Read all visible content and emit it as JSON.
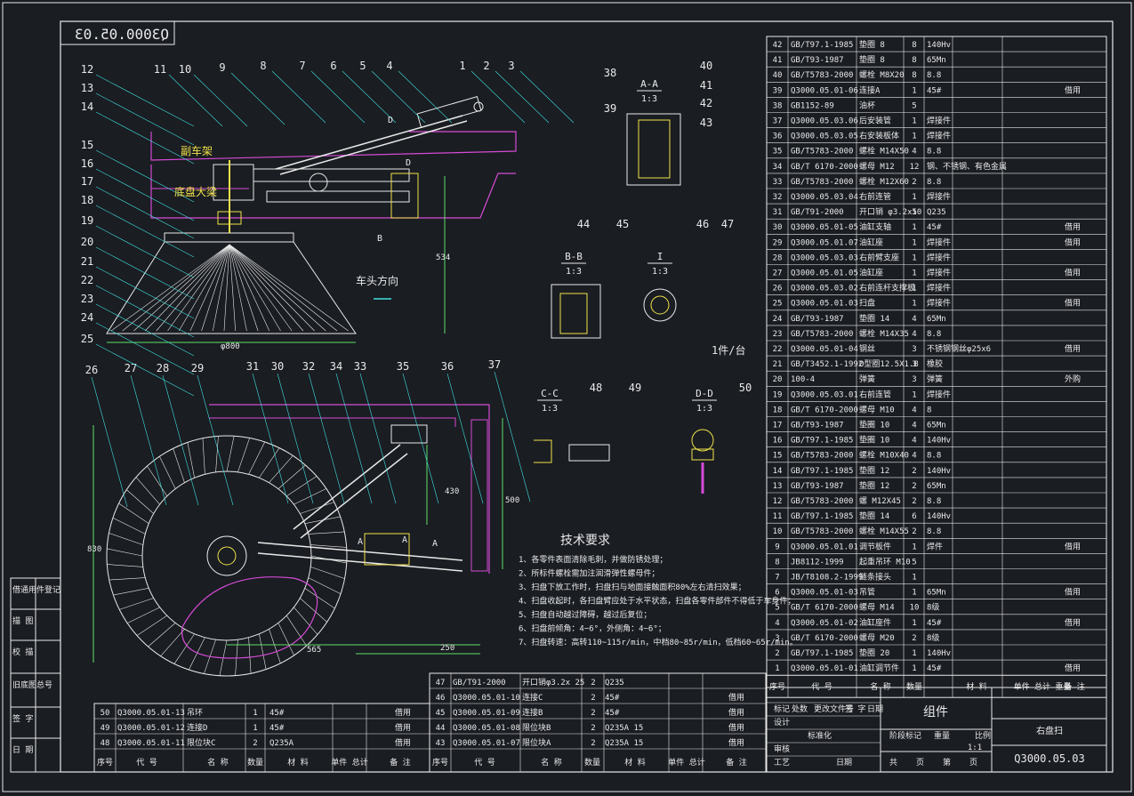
{
  "drawing": {
    "mirror_number": "Q3000.05.03",
    "title_block": {
      "name": "组件",
      "code": "Q3000.05.03",
      "scale_note": "1:1",
      "right_label": "右盘扫"
    },
    "notes_quantity": "1件/台",
    "direction_label": "车头方向",
    "frame_labels": {
      "top": "副车架",
      "bottom": "底盘大梁"
    },
    "dimensions": {
      "d1": "534",
      "d2": "φ800",
      "d3": "430",
      "d4": "500",
      "d5": "830",
      "d6": "565",
      "d7": "250"
    },
    "callouts_top": [
      "12",
      "13",
      "14",
      "15",
      "16",
      "17",
      "18",
      "19",
      "20",
      "21",
      "22",
      "23",
      "24",
      "25",
      "11",
      "10",
      "9",
      "8",
      "7",
      "6",
      "5",
      "4",
      "1",
      "2",
      "3"
    ],
    "callouts_bottom": [
      "26",
      "27",
      "28",
      "29",
      "31",
      "30",
      "32",
      "34",
      "33",
      "35",
      "36",
      "37"
    ],
    "section_views": [
      {
        "title": "A-A",
        "scale": "1:3",
        "balloons": [
          "38",
          "39",
          "40",
          "41",
          "42",
          "43"
        ]
      },
      {
        "title": "B-B",
        "scale": "1:3",
        "balloons": [
          "44",
          "45"
        ]
      },
      {
        "title": "I",
        "scale": "1:3",
        "balloons": [
          "46",
          "47"
        ]
      },
      {
        "title": "C-C",
        "scale": "1:3",
        "balloons": [
          "48",
          "49"
        ]
      },
      {
        "title": "D-D",
        "scale": "1:3",
        "balloons": [
          "50"
        ]
      }
    ],
    "section_markers": [
      "A",
      "A",
      "B",
      "D",
      "D",
      "A"
    ],
    "tech_requirements": {
      "title": "技术要求",
      "lines": [
        "1、各零件表面清除毛刺，并做防锈处理；",
        "2、所标件螺栓需加注润滑弹性螺母件；",
        "3、扫盘下放工作时，扫盘扫与地面接触面积80%左右清扫效果；",
        "4、扫盘收起时，各扫盘臂应处于水平状态，扫盘各零件部件不得低于车身件；",
        "5、扫盘自动越过障碍，越过后复位；",
        "6、扫盘前倾角：4~6°，外侧角：4~6°；",
        "7、扫盘转速：高转110~115r/min，中档80~85r/min，低档60~65r/min。"
      ]
    },
    "left_strip": [
      "借通用件登记",
      "描  图",
      "校  描",
      "旧底图总号",
      "签  字",
      "日  期"
    ],
    "bom_right_header": [
      "序号",
      "代  号",
      "名  称",
      "数量",
      "材  料",
      "单件 总计 重量",
      "备  注"
    ],
    "bom_right": [
      [
        "42",
        "GB/T97.1-1985",
        "垫圈 8",
        "8",
        "140Hv",
        ""
      ],
      [
        "41",
        "GB/T93-1987",
        "垫圈 8",
        "8",
        "65Mn",
        ""
      ],
      [
        "40",
        "GB/T5783-2000",
        "螺栓 M8X20",
        "8",
        "8.8",
        ""
      ],
      [
        "39",
        "Q3000.05.01-06",
        "连接A",
        "1",
        "45#",
        "借用"
      ],
      [
        "38",
        "GB1152-89",
        "油杯",
        "5",
        "",
        ""
      ],
      [
        "37",
        "Q3000.05.03.06",
        "后安装管",
        "1",
        "焊接件",
        ""
      ],
      [
        "36",
        "Q3000.05.03.05",
        "右安装板体",
        "1",
        "焊接件",
        ""
      ],
      [
        "35",
        "GB/T5783-2000",
        "螺栓 M14X50",
        "4",
        "8.8",
        ""
      ],
      [
        "34",
        "GB/T 6170-2000",
        "螺母 M12",
        "12",
        "钢、不锈钢、有色金属",
        ""
      ],
      [
        "33",
        "GB/T5783-2000",
        "螺栓 M12X60",
        "2",
        "8.8",
        ""
      ],
      [
        "32",
        "Q3000.05.03.04",
        "右前连管",
        "1",
        "焊接件",
        ""
      ],
      [
        "31",
        "GB/T91-2000",
        "开口销 φ3.2x50",
        "1",
        "Q235",
        ""
      ],
      [
        "30",
        "Q3000.05.01-05",
        "油缸支轴",
        "1",
        "45#",
        "借用"
      ],
      [
        "29",
        "Q3000.05.01.07",
        "油缸座",
        "1",
        "焊接件",
        "借用"
      ],
      [
        "28",
        "Q3000.05.03.03",
        "右前臂支座",
        "1",
        "焊接件",
        ""
      ],
      [
        "27",
        "Q3000.05.01.05",
        "油缸座",
        "1",
        "焊接件",
        "借用"
      ],
      [
        "26",
        "Q3000.05.03.02",
        "右前连杆支撑板",
        "1",
        "焊接件",
        ""
      ],
      [
        "25",
        "Q3000.05.01.03",
        "扫盘",
        "1",
        "焊接件",
        "借用"
      ],
      [
        "24",
        "GB/T93-1987",
        "垫圈 14",
        "4",
        "65Mn",
        ""
      ],
      [
        "23",
        "GB/T5783-2000",
        "螺栓 M14X35",
        "4",
        "8.8",
        ""
      ],
      [
        "22",
        "Q3000.05.01-04",
        "钢丝",
        "3",
        "不锈钢钢丝φ25x6",
        "借用"
      ],
      [
        "21",
        "GB/T3452.1-1992",
        "O型圈12.5X1.8",
        "3",
        "橡胶",
        ""
      ],
      [
        "20",
        "100-4",
        "弹簧",
        "3",
        "弹簧",
        "外购"
      ],
      [
        "19",
        "Q3000.05.03.01",
        "右前连管",
        "1",
        "焊接件",
        ""
      ],
      [
        "18",
        "GB/T 6170-2000",
        "螺母 M10",
        "4",
        "8",
        ""
      ],
      [
        "17",
        "GB/T93-1987",
        "垫圈 10",
        "4",
        "65Mn",
        ""
      ],
      [
        "16",
        "GB/T97.1-1985",
        "垫圈 10",
        "4",
        "140Hv",
        ""
      ],
      [
        "15",
        "GB/T5783-2000",
        "螺栓 M10X40",
        "4",
        "8.8",
        ""
      ],
      [
        "14",
        "GB/T97.1-1985",
        "垫圈 12",
        "2",
        "140Hv",
        ""
      ],
      [
        "13",
        "GB/T93-1987",
        "垫圈 12",
        "2",
        "65Mn",
        ""
      ],
      [
        "12",
        "GB/T5783-2000",
        "螺 M12X45",
        "2",
        "8.8",
        ""
      ],
      [
        "11",
        "GB/T97.1-1985",
        "垫圈 14",
        "6",
        "140Hv",
        ""
      ],
      [
        "10",
        "GB/T5783-2000",
        "螺栓 M14X55",
        "2",
        "8.8",
        ""
      ],
      [
        "9",
        "Q3000.05.01.01",
        "调节板件",
        "1",
        "焊件",
        "借用"
      ],
      [
        "8",
        "JB8112-1999",
        "起重吊环 M10",
        "5",
        "",
        ""
      ],
      [
        "7",
        "JB/T8108.2-1999",
        "链条接头",
        "1",
        "",
        ""
      ],
      [
        "6",
        "Q3000.05.01-03",
        "吊管",
        "1",
        "65Mn",
        "借用"
      ],
      [
        "5",
        "GB/T 6170-2000",
        "螺母 M14",
        "10",
        "8级",
        ""
      ],
      [
        "4",
        "Q3000.05.01-02",
        "油缸座件",
        "1",
        "45#",
        "借用"
      ],
      [
        "3",
        "GB/T 6170-2000",
        "螺母 M20",
        "2",
        "8级",
        ""
      ],
      [
        "2",
        "GB/T97.1-1985",
        "垫圈 20",
        "1",
        "140Hv",
        ""
      ],
      [
        "1",
        "Q3000.05.01-01",
        "油缸调节件",
        "1",
        "45#",
        "借用"
      ]
    ],
    "bom_mid": [
      [
        "47",
        "GB/T91-2000",
        "开口销φ3.2x 25",
        "2",
        "Q235",
        ""
      ],
      [
        "46",
        "Q3000.05.01-10",
        "连接C",
        "2",
        "45#",
        "借用"
      ],
      [
        "45",
        "Q3000.05.01-09",
        "连接B",
        "2",
        "45#",
        "借用"
      ],
      [
        "44",
        "Q3000.05.01-08",
        "限位块B",
        "2",
        "Q235A 15",
        "借用"
      ],
      [
        "43",
        "Q3000.05.01-07",
        "限位块A",
        "2",
        "Q235A 15",
        "借用"
      ]
    ],
    "bom_left": [
      [
        "50",
        "Q3000.05.01-13",
        "吊环",
        "1",
        "45#",
        "借用"
      ],
      [
        "49",
        "Q3000.05.01-12",
        "连接D",
        "1",
        "45#",
        "借用"
      ],
      [
        "48",
        "Q3000.05.01-11",
        "限位块C",
        "2",
        "Q235A",
        "借用"
      ]
    ],
    "bom_small_header": [
      "序号",
      "代  号",
      "名  称",
      "数量",
      "材  料",
      "单件 总计",
      "备  注"
    ],
    "title_block_small": [
      "标记",
      "处数",
      "更改文件号",
      "签 字",
      "日期",
      "设计",
      "标准化",
      "审核",
      "工艺",
      "日期",
      "阶段标记",
      "重量",
      "比例",
      "共",
      "页",
      "第",
      "页"
    ]
  }
}
